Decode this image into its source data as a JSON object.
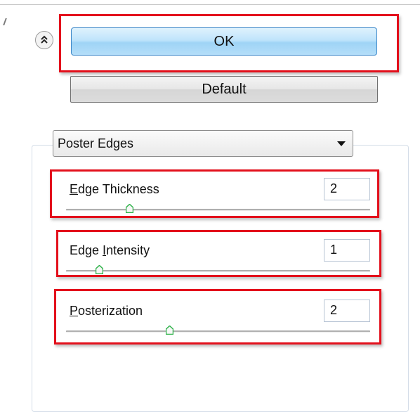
{
  "buttons": {
    "ok_label": "OK",
    "default_label": "Default"
  },
  "collapse": {
    "glyph": "˄"
  },
  "filter": {
    "selected": "Poster Edges"
  },
  "sliders": [
    {
      "label_first": "E",
      "label_rest": "dge Thickness",
      "value": "2",
      "level": 0.21
    },
    {
      "label_pre": "Edge ",
      "label_first": "I",
      "label_rest": "ntensity",
      "value": "1",
      "level": 0.11
    },
    {
      "label_first": "P",
      "label_rest": "osterization",
      "value": "2",
      "level": 0.34
    }
  ],
  "colors": {
    "highlight": "#e3101c",
    "ok_gradient_mid": "#bfe4fb",
    "thumb_green": "#2fb34a"
  }
}
